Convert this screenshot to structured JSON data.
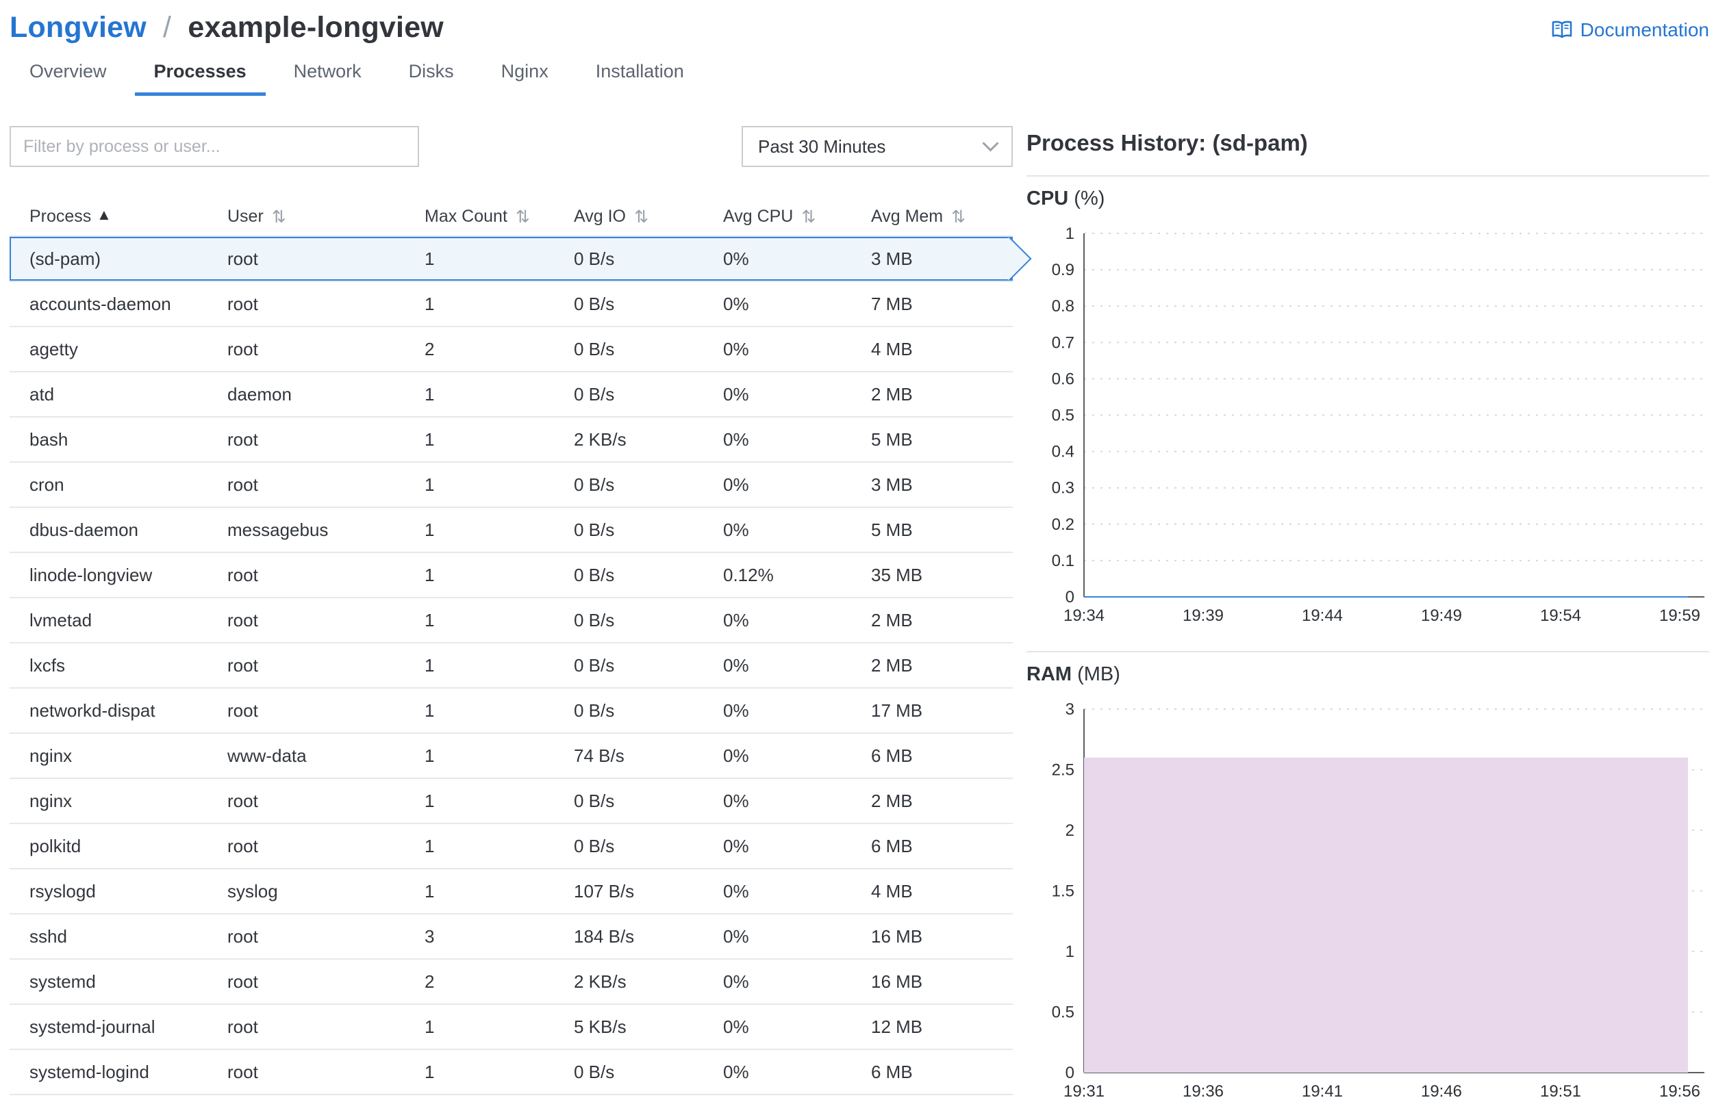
{
  "header": {
    "breadcrumb_root": "Longview",
    "breadcrumb_separator": "/",
    "breadcrumb_current": "example-longview",
    "documentation_label": "Documentation"
  },
  "tabs": [
    {
      "label": "Overview",
      "active": false
    },
    {
      "label": "Processes",
      "active": true
    },
    {
      "label": "Network",
      "active": false
    },
    {
      "label": "Disks",
      "active": false
    },
    {
      "label": "Nginx",
      "active": false
    },
    {
      "label": "Installation",
      "active": false
    }
  ],
  "filters": {
    "search_placeholder": "Filter by process or user...",
    "time_range": "Past 30 Minutes"
  },
  "icons": {
    "sort_ascending": "▲",
    "sort_both": "⇅"
  },
  "colors": {
    "accent_blue": "#2575d2",
    "tab_underline": "#3683dc",
    "selected_row_bg": "#eef5fb",
    "selected_row_border": "#3683dc",
    "cpu_line": "#3683dc",
    "ram_fill": "#e9d7ec"
  },
  "table": {
    "columns": [
      {
        "label": "Process",
        "sort": "asc"
      },
      {
        "label": "User",
        "sort": "both"
      },
      {
        "label": "Max Count",
        "sort": "both"
      },
      {
        "label": "Avg IO",
        "sort": "both"
      },
      {
        "label": "Avg CPU",
        "sort": "both"
      },
      {
        "label": "Avg Mem",
        "sort": "both"
      }
    ],
    "rows": [
      {
        "process": "(sd-pam)",
        "user": "root",
        "max_count": "1",
        "avg_io": "0 B/s",
        "avg_cpu": "0%",
        "avg_mem": "3 MB",
        "selected": true
      },
      {
        "process": "accounts-daemon",
        "user": "root",
        "max_count": "1",
        "avg_io": "0 B/s",
        "avg_cpu": "0%",
        "avg_mem": "7 MB",
        "selected": false
      },
      {
        "process": "agetty",
        "user": "root",
        "max_count": "2",
        "avg_io": "0 B/s",
        "avg_cpu": "0%",
        "avg_mem": "4 MB",
        "selected": false
      },
      {
        "process": "atd",
        "user": "daemon",
        "max_count": "1",
        "avg_io": "0 B/s",
        "avg_cpu": "0%",
        "avg_mem": "2 MB",
        "selected": false
      },
      {
        "process": "bash",
        "user": "root",
        "max_count": "1",
        "avg_io": "2 KB/s",
        "avg_cpu": "0%",
        "avg_mem": "5 MB",
        "selected": false
      },
      {
        "process": "cron",
        "user": "root",
        "max_count": "1",
        "avg_io": "0 B/s",
        "avg_cpu": "0%",
        "avg_mem": "3 MB",
        "selected": false
      },
      {
        "process": "dbus-daemon",
        "user": "messagebus",
        "max_count": "1",
        "avg_io": "0 B/s",
        "avg_cpu": "0%",
        "avg_mem": "5 MB",
        "selected": false
      },
      {
        "process": "linode-longview",
        "user": "root",
        "max_count": "1",
        "avg_io": "0 B/s",
        "avg_cpu": "0.12%",
        "avg_mem": "35 MB",
        "selected": false
      },
      {
        "process": "lvmetad",
        "user": "root",
        "max_count": "1",
        "avg_io": "0 B/s",
        "avg_cpu": "0%",
        "avg_mem": "2 MB",
        "selected": false
      },
      {
        "process": "lxcfs",
        "user": "root",
        "max_count": "1",
        "avg_io": "0 B/s",
        "avg_cpu": "0%",
        "avg_mem": "2 MB",
        "selected": false
      },
      {
        "process": "networkd-dispat",
        "user": "root",
        "max_count": "1",
        "avg_io": "0 B/s",
        "avg_cpu": "0%",
        "avg_mem": "17 MB",
        "selected": false
      },
      {
        "process": "nginx",
        "user": "www-data",
        "max_count": "1",
        "avg_io": "74 B/s",
        "avg_cpu": "0%",
        "avg_mem": "6 MB",
        "selected": false
      },
      {
        "process": "nginx",
        "user": "root",
        "max_count": "1",
        "avg_io": "0 B/s",
        "avg_cpu": "0%",
        "avg_mem": "2 MB",
        "selected": false
      },
      {
        "process": "polkitd",
        "user": "root",
        "max_count": "1",
        "avg_io": "0 B/s",
        "avg_cpu": "0%",
        "avg_mem": "6 MB",
        "selected": false
      },
      {
        "process": "rsyslogd",
        "user": "syslog",
        "max_count": "1",
        "avg_io": "107 B/s",
        "avg_cpu": "0%",
        "avg_mem": "4 MB",
        "selected": false
      },
      {
        "process": "sshd",
        "user": "root",
        "max_count": "3",
        "avg_io": "184 B/s",
        "avg_cpu": "0%",
        "avg_mem": "16 MB",
        "selected": false
      },
      {
        "process": "systemd",
        "user": "root",
        "max_count": "2",
        "avg_io": "2 KB/s",
        "avg_cpu": "0%",
        "avg_mem": "16 MB",
        "selected": false
      },
      {
        "process": "systemd-journal",
        "user": "root",
        "max_count": "1",
        "avg_io": "5 KB/s",
        "avg_cpu": "0%",
        "avg_mem": "12 MB",
        "selected": false
      },
      {
        "process": "systemd-logind",
        "user": "root",
        "max_count": "1",
        "avg_io": "0 B/s",
        "avg_cpu": "0%",
        "avg_mem": "6 MB",
        "selected": false
      }
    ]
  },
  "history": {
    "title": "Process History: (sd-pam)"
  },
  "chart_data": [
    {
      "type": "line",
      "title": "CPU",
      "unit": "(%)",
      "x": [
        "19:34",
        "19:39",
        "19:44",
        "19:49",
        "19:54",
        "19:59"
      ],
      "y_ticks": [
        "1",
        "0.9",
        "0.8",
        "0.7",
        "0.6",
        "0.5",
        "0.4",
        "0.3",
        "0.2",
        "0.1",
        "0"
      ],
      "ylim": [
        0,
        1
      ],
      "grid": "dashed-horizontal",
      "legend": "none",
      "series": [
        {
          "name": "CPU",
          "values": [
            0,
            0,
            0,
            0,
            0,
            0
          ],
          "color": "#3683dc"
        }
      ]
    },
    {
      "type": "area",
      "title": "RAM",
      "unit": "(MB)",
      "x": [
        "19:31",
        "19:36",
        "19:41",
        "19:46",
        "19:51",
        "19:56"
      ],
      "y_ticks": [
        "3",
        "2.5",
        "2",
        "1.5",
        "1",
        "0.5",
        "0"
      ],
      "ylim": [
        0,
        3
      ],
      "grid": "dashed-horizontal",
      "legend": "none",
      "series": [
        {
          "name": "RAM",
          "values": [
            2.6,
            2.6,
            2.6,
            2.6,
            2.6,
            2.6
          ],
          "color": "#e9d7ec"
        }
      ]
    }
  ]
}
